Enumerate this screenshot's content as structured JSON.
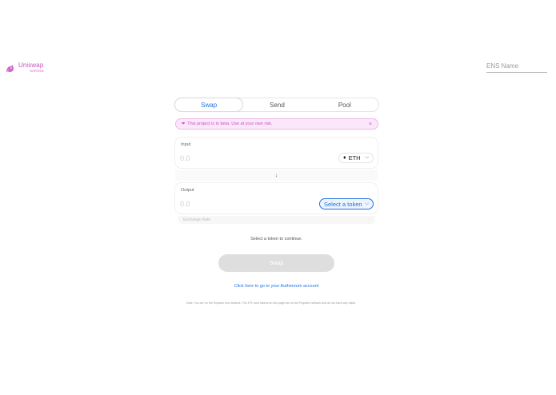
{
  "header": {
    "logo_title": "Uniswap",
    "logo_subtitle": "ROPSTEN",
    "ens_placeholder": "ENS Name"
  },
  "tabs": [
    {
      "label": "Swap",
      "active": true
    },
    {
      "label": "Send",
      "active": false
    },
    {
      "label": "Pool",
      "active": false
    }
  ],
  "banner": {
    "heart": "❤",
    "text": "This project is in beta. Use at your own risk.",
    "close": "×"
  },
  "input": {
    "label": "Input",
    "placeholder": "0.0",
    "token_icon": "♦",
    "token": "ETH",
    "chevron": "⌵"
  },
  "arrow": "↓",
  "output": {
    "label": "Output",
    "placeholder": "0.0",
    "token": "Select a token",
    "chevron": "⌵"
  },
  "exchange_rate": {
    "label": "Exchange Rate",
    "value": "-"
  },
  "status": "Select a token to continue.",
  "swap_button": "Swap",
  "authereum_link": "Click here to go to your Authereum account",
  "note": "Note: You are on the Ropsten test network. The ETH and tokens on this page are on the Ropsten network and do not have any value.",
  "colors": {
    "brand_pink": "#c751c0",
    "accent_blue": "#2172e5",
    "banner_bg": "#fbe7fa"
  }
}
